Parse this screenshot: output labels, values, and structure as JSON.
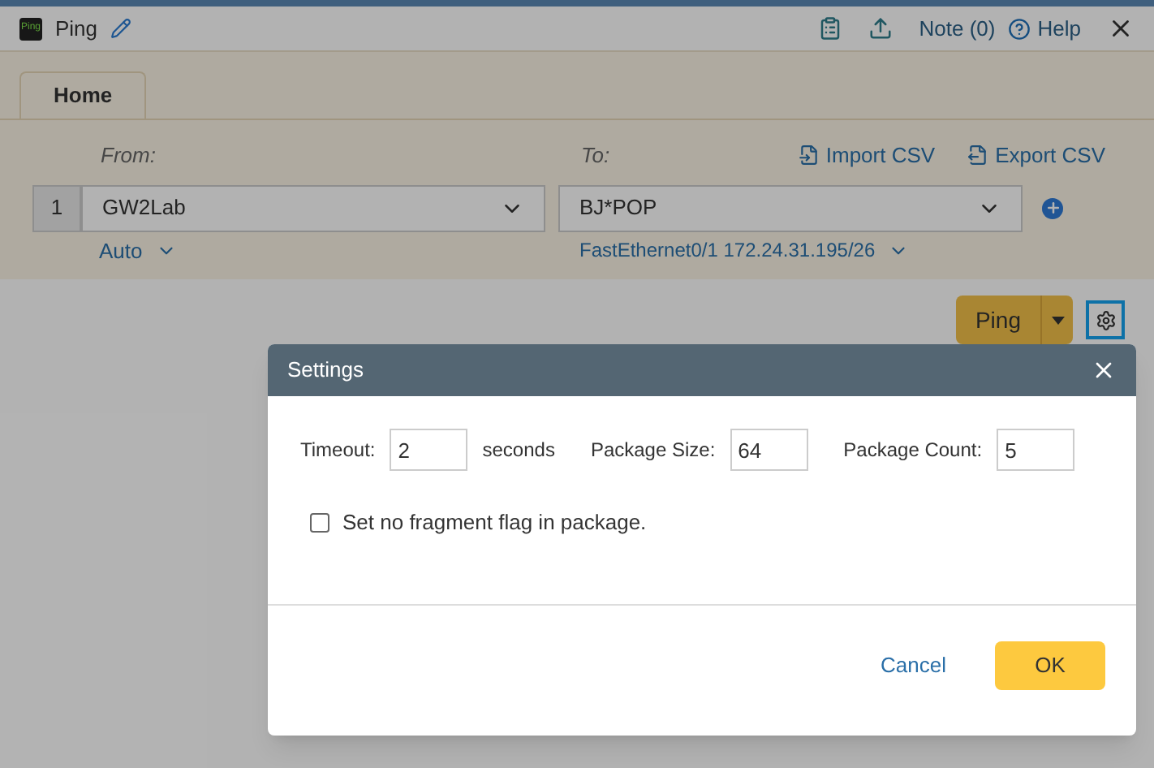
{
  "window": {
    "logo_text": "Ping",
    "title": "Ping",
    "note": "Note (0)",
    "help": "Help"
  },
  "tabs": [
    {
      "label": "Home",
      "selected": true
    }
  ],
  "route": {
    "from_label": "From:",
    "to_label": "To:",
    "import": "Import CSV",
    "export": "Export CSV",
    "rows": [
      {
        "index": "1",
        "from": "GW2Lab",
        "to": "BJ*POP",
        "from_sub": "Auto",
        "to_sub": "FastEthernet0/1 172.24.31.195/26"
      }
    ]
  },
  "ping_button": "Ping",
  "settings_button": {
    "focused": true
  },
  "dialog": {
    "title": "Settings",
    "fields": [
      {
        "label": "Timeout:",
        "value": "2",
        "unit": "seconds"
      },
      {
        "label": "Package Size:",
        "value": "64"
      },
      {
        "label": "Package Count:",
        "value": "5"
      }
    ],
    "checkbox": {
      "label": "Set no fragment flag in package.",
      "checked": false
    },
    "cancel": "Cancel",
    "ok": "OK"
  }
}
